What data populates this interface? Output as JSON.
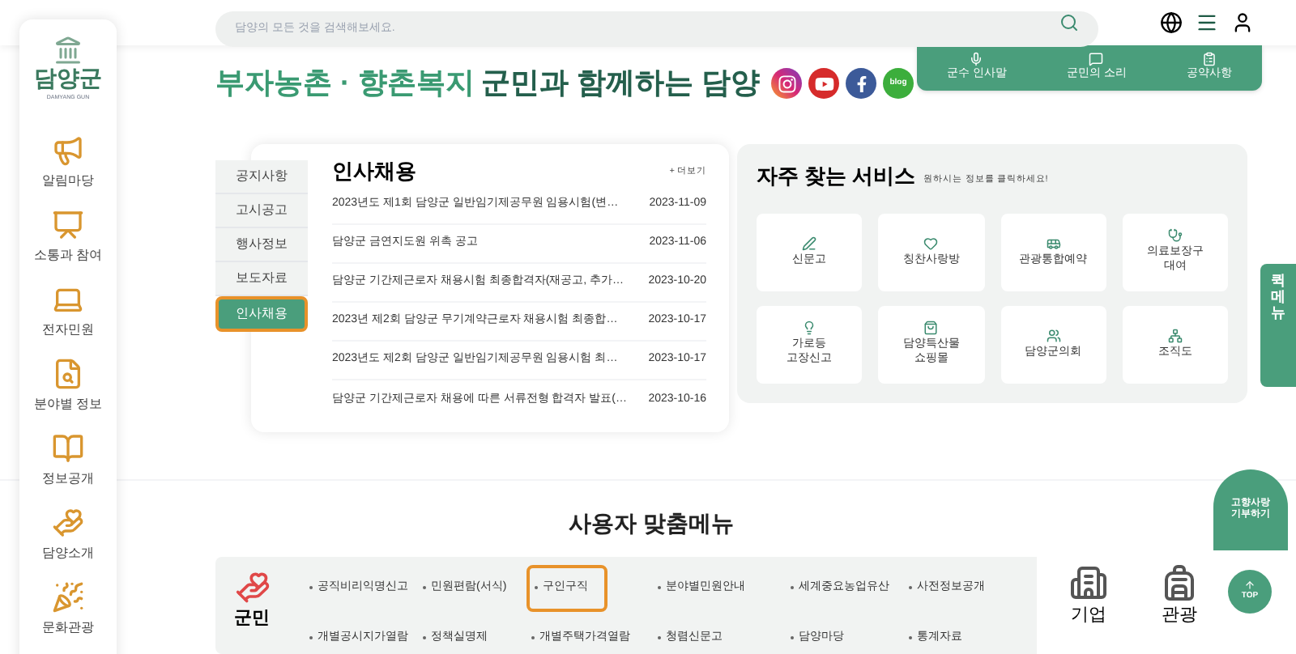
{
  "logo": {
    "name": "담양군",
    "subtitle": "DAMYANG GUN"
  },
  "sidebar": {
    "items": [
      {
        "label": "알림마당",
        "kind": "megaphone"
      },
      {
        "label": "소통과 참여",
        "kind": "presentation"
      },
      {
        "label": "전자민원",
        "kind": "laptop"
      },
      {
        "label": "분야별 정보",
        "kind": "search"
      },
      {
        "label": "정보공개",
        "kind": "book"
      },
      {
        "label": "담양소개",
        "kind": "hands"
      },
      {
        "label": "문화관광",
        "kind": "balloon"
      }
    ]
  },
  "search": {
    "placeholder": "담양의 모든 것을 검색해보세요."
  },
  "headline": {
    "highlight": "부자농촌 · 향촌복지",
    "rest": "군민과 함께하는 담양"
  },
  "social": [
    {
      "kind": "instagram"
    },
    {
      "kind": "youtube"
    },
    {
      "kind": "facebook"
    },
    {
      "kind": "blog",
      "label": "blog"
    }
  ],
  "top_tabs": [
    {
      "label": "군수 인사말",
      "kind": "mic"
    },
    {
      "label": "군민의 소리",
      "kind": "message"
    },
    {
      "label": "공약사항",
      "kind": "clipboard"
    }
  ],
  "board": {
    "tabs": [
      {
        "label": "공지사항",
        "selected": false
      },
      {
        "label": "고시공고",
        "selected": false
      },
      {
        "label": "행사정보",
        "selected": false
      },
      {
        "label": "보도자료",
        "selected": false
      },
      {
        "label": "인사채용",
        "selected": true
      }
    ],
    "title": "인사채용",
    "more": "+ 더보기",
    "rows": [
      {
        "title": "2023년도 제1회 담양군 일반임기제공무원 임용시험(변…",
        "date": "2023-11-09"
      },
      {
        "title": "담양군 금연지도원 위촉 공고",
        "date": "2023-11-06"
      },
      {
        "title": "담양군 기간제근로자 채용시험 최종합격자(재공고, 추가…",
        "date": "2023-10-20"
      },
      {
        "title": "2023년 제2회 담양군 무기계약근로자 채용시험 최종합…",
        "date": "2023-10-17"
      },
      {
        "title": "2023년도 제2회 담양군 일반임기제공무원 임용시험 최…",
        "date": "2023-10-17"
      },
      {
        "title": "담양군 기간제근로자 채용에 따른 서류전형 합격자 발표(…",
        "date": "2023-10-16"
      }
    ]
  },
  "services": {
    "title": "자주 찾는 서비스",
    "subtitle": "원하시는 정보를 클릭하세요!",
    "items": [
      {
        "label": "신문고",
        "kind": "pen"
      },
      {
        "label": "칭찬사랑방",
        "kind": "heart"
      },
      {
        "label": "관광통합예약",
        "kind": "bus"
      },
      {
        "label": "의료보장구\n대여",
        "kind": "stethoscope"
      },
      {
        "label": "가로등\n고장신고",
        "kind": "bulb"
      },
      {
        "label": "담양특산물\n쇼핑몰",
        "kind": "bag"
      },
      {
        "label": "담양군의회",
        "kind": "users"
      },
      {
        "label": "조직도",
        "kind": "network"
      }
    ]
  },
  "quick_menu": {
    "label": "퀵메뉴"
  },
  "donation": {
    "label": "고향사랑\n기부하기"
  },
  "top_button": {
    "label": "TOP"
  },
  "user_menu": {
    "title": "사용자 맞춤메뉴",
    "citizen": {
      "label": "군민",
      "links": [
        {
          "label": "공직비리익명신고",
          "selected": false
        },
        {
          "label": "민원편람(서식)",
          "selected": false
        },
        {
          "label": "구인구직",
          "selected": true
        },
        {
          "label": "분야별민원안내",
          "selected": false
        },
        {
          "label": "세계중요농업유산",
          "selected": false
        },
        {
          "label": "사전정보공개",
          "selected": false
        },
        {
          "label": "개별공시지가열람",
          "selected": false
        },
        {
          "label": "정책실명제",
          "selected": false
        },
        {
          "label": "개별주택가격열람",
          "selected": false
        },
        {
          "label": "청렴신문고",
          "selected": false
        },
        {
          "label": "담양마당",
          "selected": false
        },
        {
          "label": "통계자료",
          "selected": false
        }
      ]
    },
    "others": [
      {
        "label": "기업",
        "kind": "building"
      },
      {
        "label": "관광",
        "kind": "backpack"
      }
    ]
  }
}
